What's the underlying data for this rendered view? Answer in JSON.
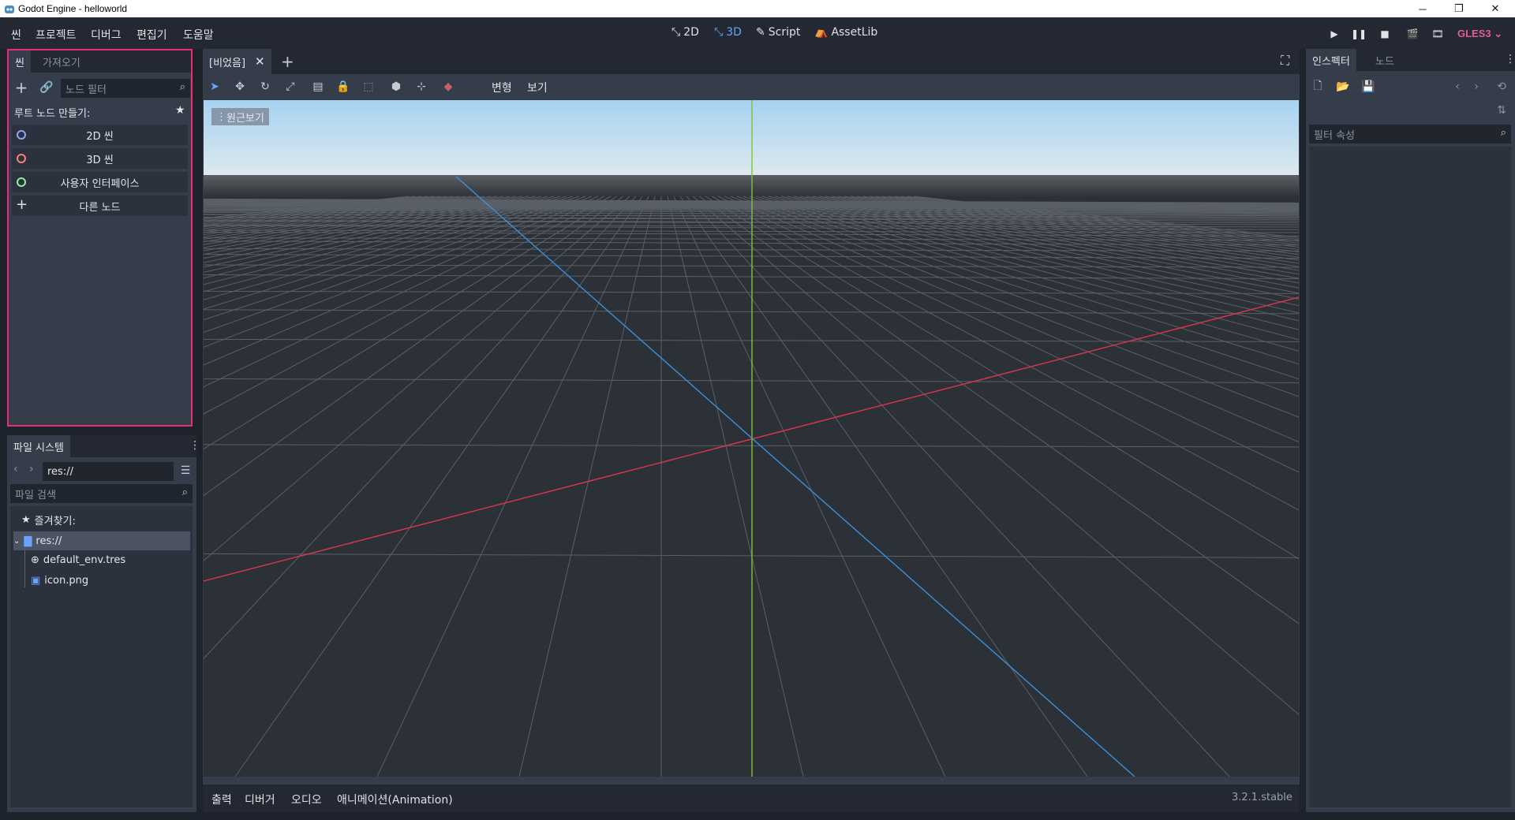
{
  "window": {
    "title": "Godot Engine - helloworld"
  },
  "menu": {
    "items": [
      "씬",
      "프로젝트",
      "디버그",
      "편집기",
      "도움말"
    ]
  },
  "workspaces": [
    {
      "label": "2D",
      "active": false
    },
    {
      "label": "3D",
      "active": true
    },
    {
      "label": "Script",
      "active": false
    },
    {
      "label": "AssetLib",
      "active": false
    }
  ],
  "renderer": "GLES3",
  "scene_dock": {
    "tabs": [
      "씬",
      "가져오기"
    ],
    "filter_placeholder": "노드 필터",
    "create_root_label": "루트 노드 만들기:",
    "options": [
      {
        "label": "2D 씬",
        "icon": "node2d-icon",
        "color": "#8da5f3"
      },
      {
        "label": "3D 씬",
        "icon": "spatial-icon",
        "color": "#fc7f7f"
      },
      {
        "label": "사용자 인터페이스",
        "icon": "control-icon",
        "color": "#8eef97"
      },
      {
        "label": "다른 노드",
        "icon": "plus-icon",
        "color": "#e3e6eb"
      }
    ]
  },
  "filesystem": {
    "tab": "파일 시스템",
    "path": "res://",
    "search_placeholder": "파일 검색",
    "favorites_label": "즐겨찾기:",
    "root": "res://",
    "files": [
      {
        "name": "default_env.tres",
        "icon": "environment-icon"
      },
      {
        "name": "icon.png",
        "icon": "image-icon"
      }
    ]
  },
  "editor": {
    "scene_tab": "[비었음]",
    "toolbar_menus": [
      "변형",
      "보기"
    ],
    "viewport_label": "원근보기"
  },
  "bottom_panel": {
    "tabs": [
      "출력",
      "디버거",
      "오디오",
      "애니메이션(Animation)"
    ],
    "version": "3.2.1.stable"
  },
  "inspector": {
    "tabs": [
      "인스펙터",
      "노드"
    ],
    "filter_placeholder": "필터 속성"
  },
  "colors": {
    "accent": "#6aa3ff",
    "highlight_border": "#e52e76",
    "x_axis": "#e0344f",
    "y_axis": "#7ec437",
    "z_axis": "#3b8fdd"
  }
}
